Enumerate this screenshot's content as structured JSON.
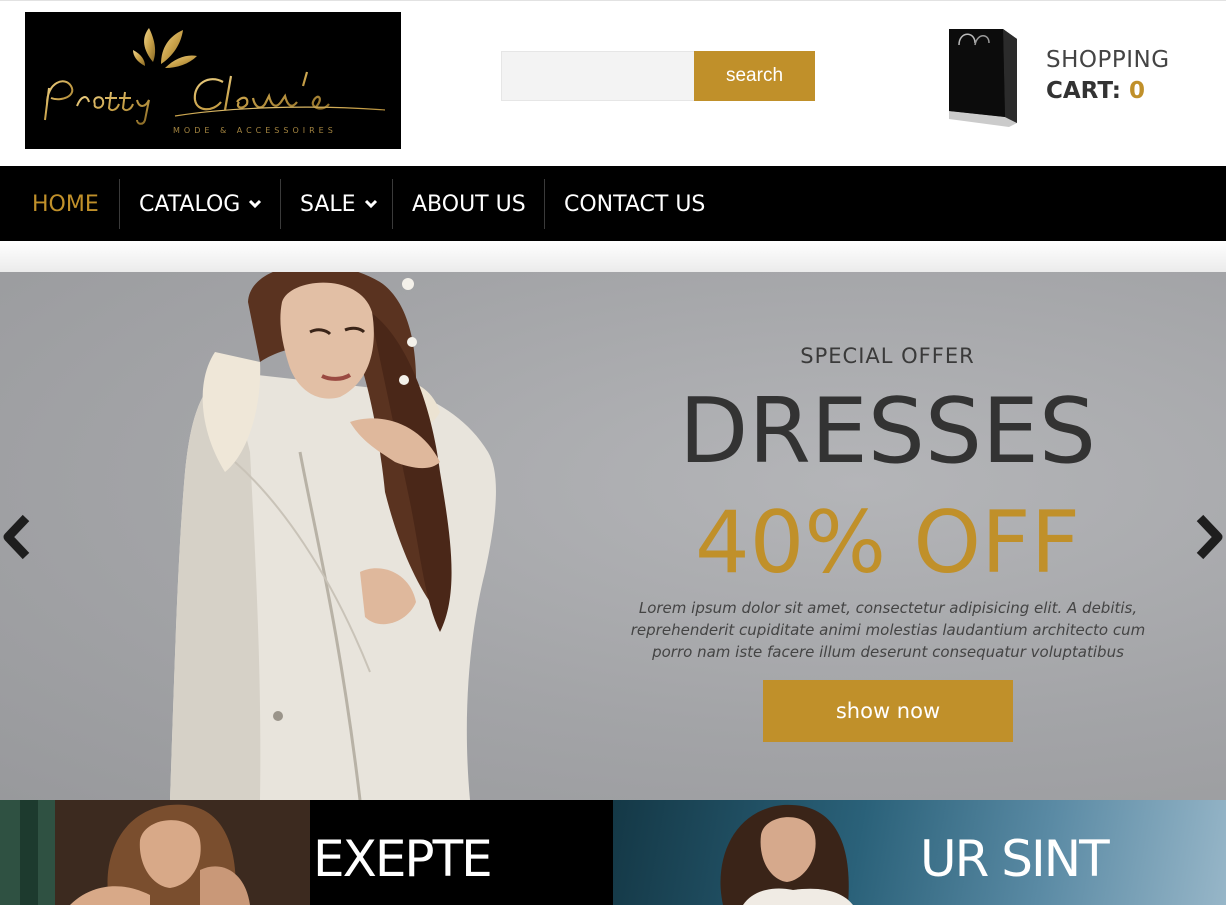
{
  "brand": {
    "name": "Pretty Clem's",
    "tagline": "MODE & ACCESSOIRES",
    "colors": {
      "accent": "#c0902a",
      "nav_bg": "#000000",
      "text_dark": "#333333"
    }
  },
  "search": {
    "placeholder": "",
    "value": "",
    "button_label": "search",
    "icon": "search-icon"
  },
  "cart": {
    "line1": "SHOPPING",
    "label": "CART:",
    "count": "0",
    "icon": "shopping-bag-icon"
  },
  "nav": {
    "items": [
      {
        "label": "HOME",
        "active": true,
        "dropdown": false
      },
      {
        "label": "CATALOG",
        "active": false,
        "dropdown": true
      },
      {
        "label": "SALE",
        "active": false,
        "dropdown": true
      },
      {
        "label": "ABOUT US",
        "active": false,
        "dropdown": false
      },
      {
        "label": "CONTACT US",
        "active": false,
        "dropdown": false
      }
    ]
  },
  "hero": {
    "kicker": "SPECIAL OFFER",
    "title": "DRESSES",
    "offer": "40% OFF",
    "description": "Lorem ipsum dolor sit amet, consectetur adipisicing elit. A debitis, reprehenderit cupiditate animi molestias laudantium architecto cum porro nam iste facere illum deserunt consequatur voluptatibus",
    "button_label": "show now",
    "prev_icon": "chevron-left-icon",
    "next_icon": "chevron-right-icon"
  },
  "tiles": [
    {
      "title": "EXEPTE"
    },
    {
      "title": "UR SINT"
    }
  ]
}
